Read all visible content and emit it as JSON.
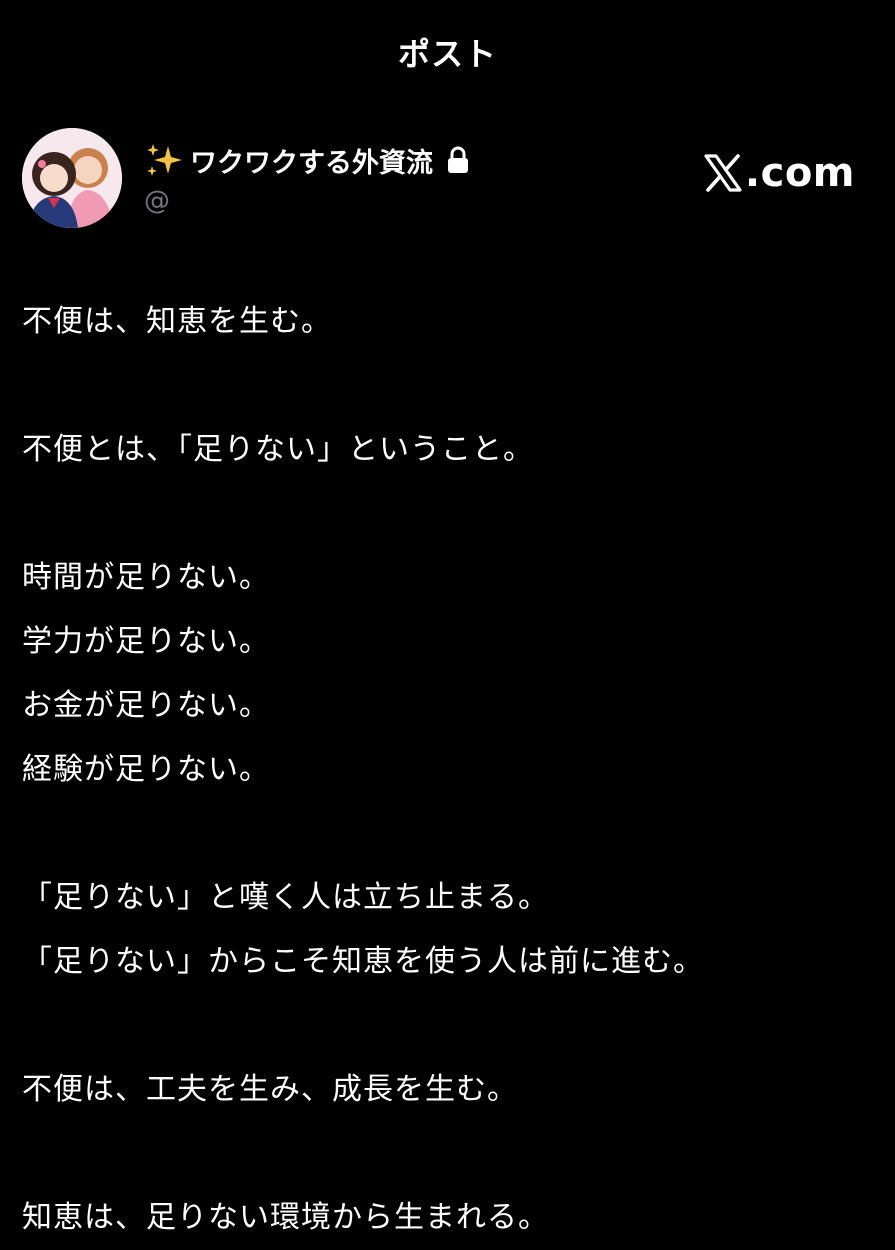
{
  "header": {
    "title": "ポスト"
  },
  "author": {
    "display_name": "ワクワクする外資流",
    "handle": "@",
    "sparkle_icon": "sparkles-icon",
    "lock_icon": "lock-icon"
  },
  "site_badge": {
    "logo": "x-logo-icon",
    "suffix": ".com"
  },
  "body": {
    "p1": "不便は、知恵を生む。",
    "p2": "不便とは、「足りない」ということ。",
    "p3": [
      "時間が足りない。",
      "学力が足りない。",
      "お金が足りない。",
      "経験が足りない。"
    ],
    "p4": [
      "「足りない」と嘆く人は立ち止まる。",
      "「足りない」からこそ知恵を使う人は前に進む。"
    ],
    "p5": "不便は、工夫を生み、成長を生む。",
    "p6": "知恵は、足りない環境から生まれる。"
  },
  "colors": {
    "background": "#000000",
    "text": "#ffffff",
    "secondary": "#71767b",
    "sparkle": "#f5c542"
  }
}
